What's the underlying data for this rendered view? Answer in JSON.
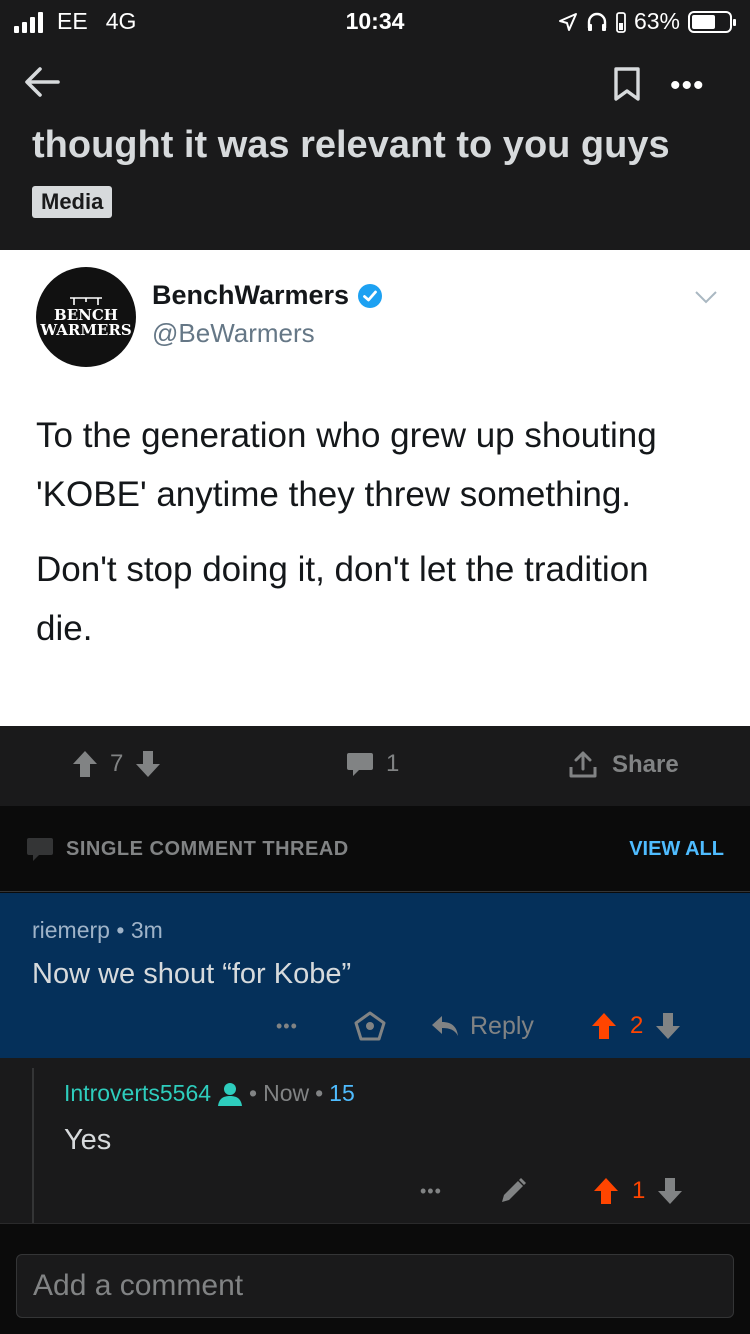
{
  "status_bar": {
    "carrier": "EE",
    "network": "4G",
    "time": "10:34",
    "battery": "63%",
    "battery_level": 0.63
  },
  "header": {
    "title": "thought it was relevant to you guys",
    "flair": "Media"
  },
  "tweet": {
    "avatar_line1": "BENCH",
    "avatar_line2": "WARMERS",
    "display_name": "BenchWarmers",
    "handle": "@BeWarmers",
    "paragraph1": "To the generation who grew up shouting 'KOBE' anytime they threw something.",
    "paragraph2": "Don't stop doing it, don't let the tradition die."
  },
  "post_actions": {
    "score": "7",
    "comment_count": "1",
    "share_label": "Share"
  },
  "thread": {
    "label": "SINGLE COMMENT THREAD",
    "view_all": "VIEW ALL"
  },
  "comment1": {
    "author": "riemerp",
    "age": "3m",
    "body": "Now we shout “for Kobe”",
    "reply_label": "Reply",
    "score": "2"
  },
  "comment2": {
    "author": "Introverts5564",
    "age": "Now",
    "flair_score": "15",
    "body": "Yes",
    "score": "1"
  },
  "composer": {
    "placeholder": "Add a comment"
  },
  "colors": {
    "upvote": "#ff4500",
    "link": "#4fbcff",
    "highlight_bg": "#05305a",
    "username_teal": "#2ecdbd"
  }
}
